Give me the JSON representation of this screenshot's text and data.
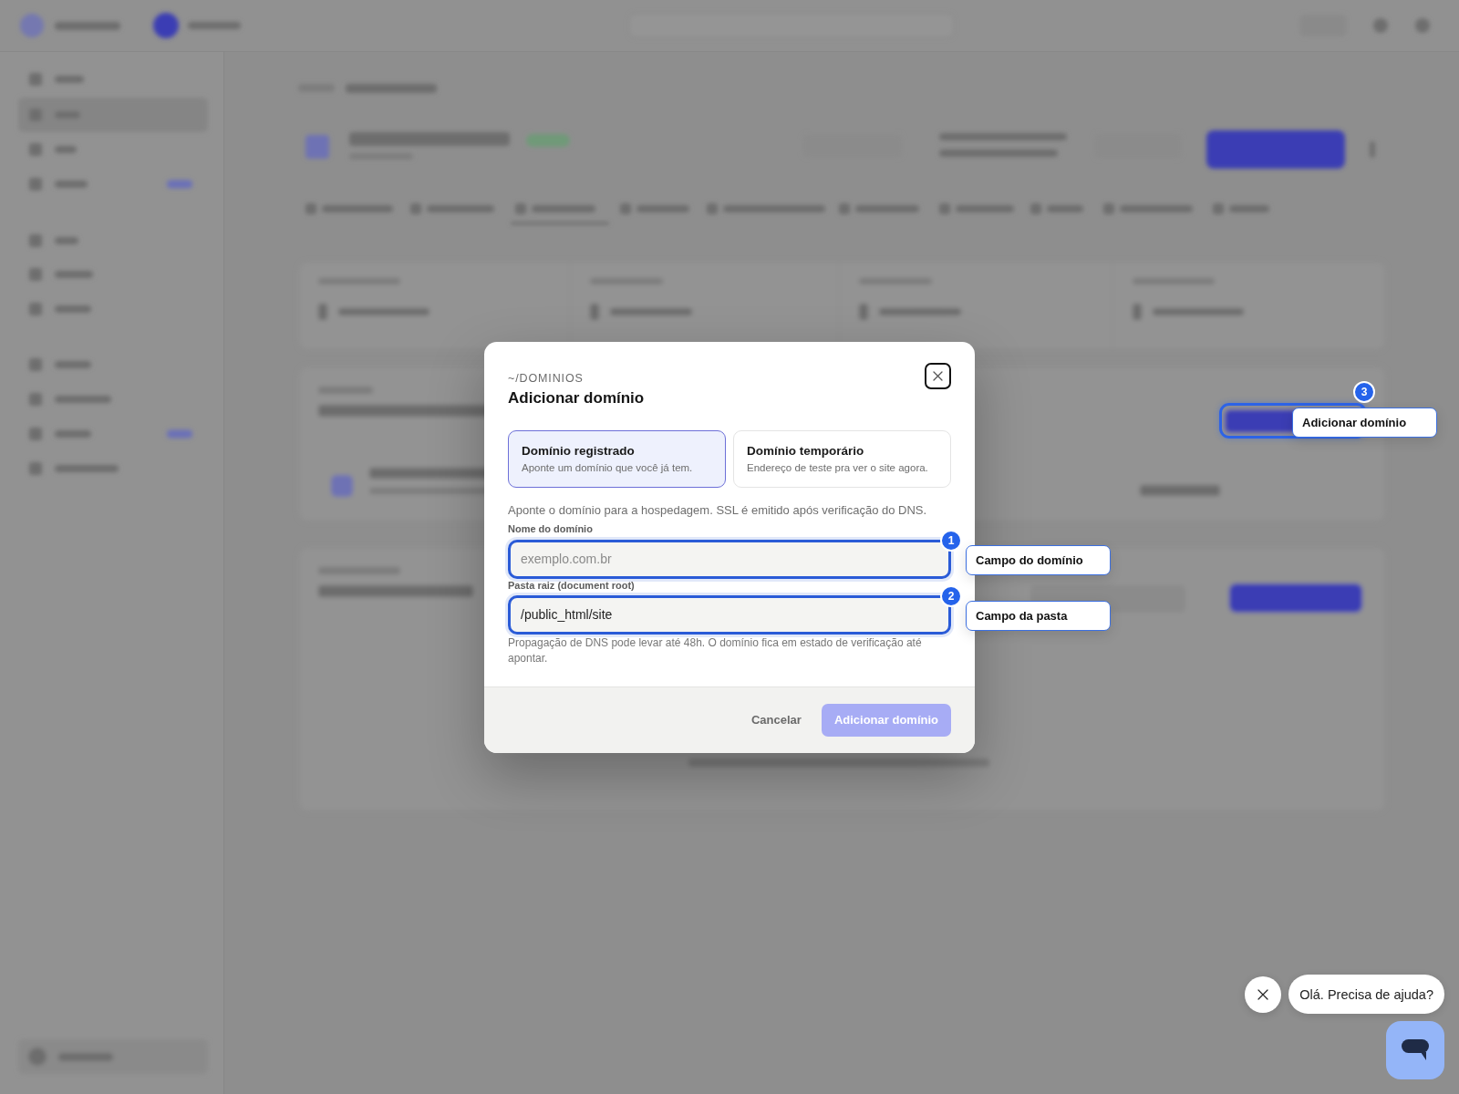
{
  "modal": {
    "eyebrow": "~/DOMINIOS",
    "title": "Adicionar domínio",
    "options": [
      {
        "title": "Domínio registrado",
        "description": "Aponte um domínio que você já tem.",
        "selected": true
      },
      {
        "title": "Domínio temporário",
        "description": "Endereço de teste pra ver o site agora.",
        "selected": false
      }
    ],
    "intro": "Aponte o domínio para a hospedagem. SSL é emitido após verificação do DNS.",
    "fields": [
      {
        "label": "Nome do domínio",
        "placeholder": "exemplo.com.br",
        "tour_step": {
          "number": "1",
          "callout": "Campo do domínio"
        }
      },
      {
        "label": "Pasta raiz (document root)",
        "value": "/public_html/site",
        "tour_step": {
          "number": "2",
          "callout": "Campo da pasta"
        }
      }
    ],
    "note": "Propagação de DNS pode levar até 48h. O domínio fica em estado de verificação até apontar.",
    "buttons": [
      {
        "label": "Cancelar",
        "kind": "secondary",
        "disabled": false
      },
      {
        "label": "Adicionar domínio",
        "kind": "primary",
        "disabled": true
      }
    ]
  },
  "page_behind_modal": {
    "tour_step": {
      "number": "3",
      "callout": "Adicionar domínio"
    }
  },
  "chat_widget": {
    "greeting": "Olá. Precisa de ajuda?"
  }
}
